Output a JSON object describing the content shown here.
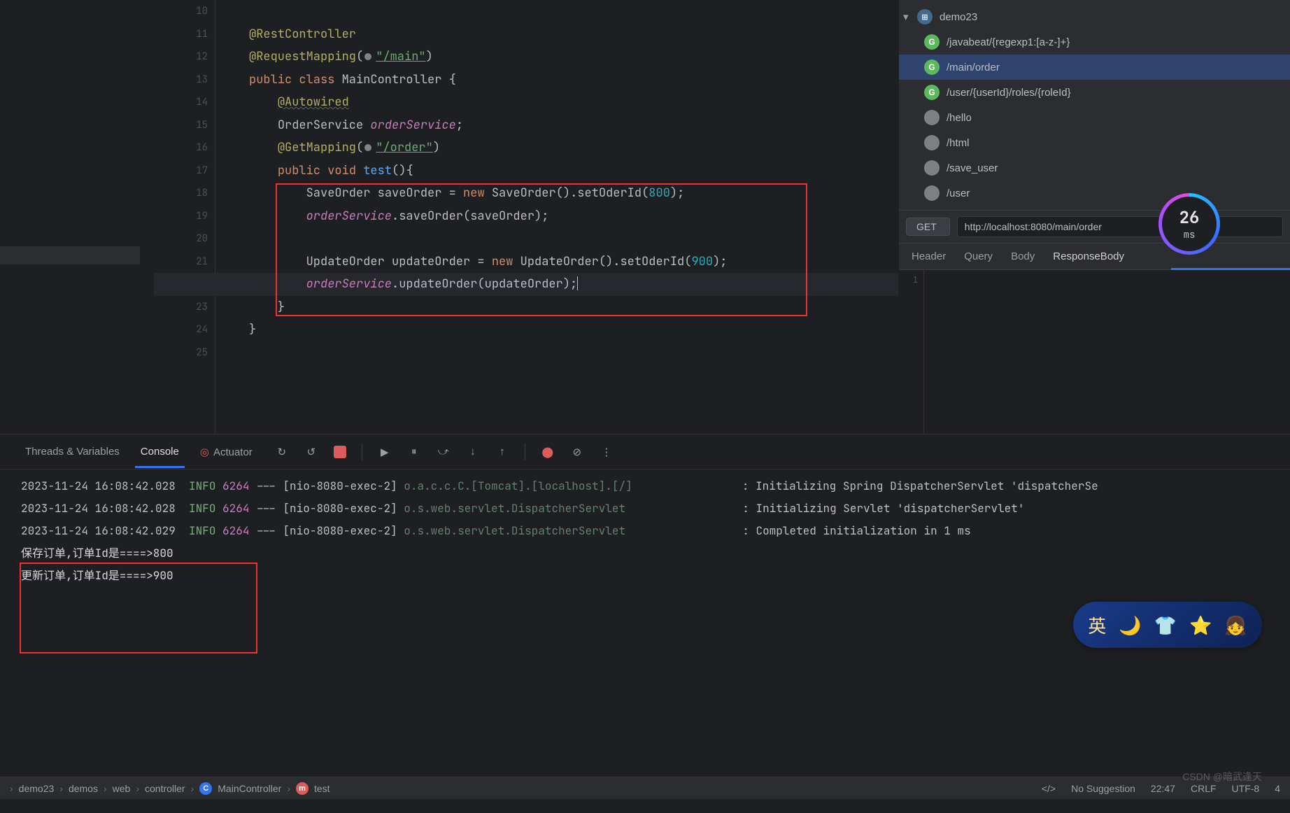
{
  "editor": {
    "lines": {
      "start": 10,
      "end": 25
    },
    "code": {
      "l11_ann": "@RestController",
      "l12_ann": "@RequestMapping",
      "l12_str": "\"/main\"",
      "l13_kw1": "public",
      "l13_kw2": "class",
      "l13_name": "MainController",
      "l14_ann": "@Autowired",
      "l15_type": "OrderService",
      "l15_field": "orderService",
      "l16_ann": "@GetMapping",
      "l16_str": "\"/order\"",
      "l17_kw1": "public",
      "l17_kw2": "void",
      "l17_name": "test",
      "l18_t1": "SaveOrder",
      "l18_v1": "saveOrder",
      "l18_kw": "new",
      "l18_t2": "SaveOrder",
      "l18_m": "setOderId",
      "l18_n": "800",
      "l19_f": "orderService",
      "l19_m": "saveOrder",
      "l19_a": "saveOrder",
      "l21_t1": "UpdateOrder",
      "l21_v1": "updateOrder",
      "l21_kw": "new",
      "l21_t2": "UpdateOrder",
      "l21_m": "setOderId",
      "l21_n": "900",
      "l22_f": "orderService",
      "l22_m": "updateOrder",
      "l22_a": "updateOrder"
    }
  },
  "endpoints_panel": {
    "root": "demo23",
    "items": [
      {
        "method": "G",
        "path": "/javabeat/{regexp1:[a-z-]+}"
      },
      {
        "method": "G",
        "path": "/main/order",
        "selected": true
      },
      {
        "method": "G",
        "path": "/user/{userId}/roles/{roleId}"
      },
      {
        "method": "",
        "path": "/hello"
      },
      {
        "method": "",
        "path": "/html"
      },
      {
        "method": "",
        "path": "/save_user"
      },
      {
        "method": "",
        "path": "/user"
      }
    ],
    "request": {
      "method": "GET",
      "url": "http://localhost:8080/main/order"
    },
    "tabs": [
      "Header",
      "Query",
      "Body",
      "ResponseBody"
    ],
    "tab_selected": "ResponseBody",
    "response_gutter": "1",
    "timing": {
      "value": "26",
      "unit": "ms"
    }
  },
  "debug_panel": {
    "tabs": {
      "threads": "Threads & Variables",
      "console": "Console",
      "actuator": "Actuator"
    },
    "log": [
      {
        "ts": "2023-11-24 16:08:42.028",
        "lvl": "INFO",
        "pid": "6264",
        "pre": "--- [nio-8080-exec-2]",
        "logger": "o.a.c.c.C.[Tomcat].[localhost].[/]",
        "msg": ": Initializing Spring DispatcherServlet 'dispatcherSe"
      },
      {
        "ts": "2023-11-24 16:08:42.028",
        "lvl": "INFO",
        "pid": "6264",
        "pre": "--- [nio-8080-exec-2]",
        "logger": "o.s.web.servlet.DispatcherServlet",
        "msg": ": Initializing Servlet 'dispatcherServlet'"
      },
      {
        "ts": "2023-11-24 16:08:42.029",
        "lvl": "INFO",
        "pid": "6264",
        "pre": "--- [nio-8080-exec-2]",
        "logger": "o.s.web.servlet.DispatcherServlet",
        "msg": ": Completed initialization in 1 ms"
      }
    ],
    "out": [
      "保存订单,订单Id是====>800",
      "更新订单,订单Id是====>900"
    ]
  },
  "status_bar": {
    "crumbs": [
      "demo23",
      "demos",
      "web",
      "controller",
      "MainController",
      "test"
    ],
    "crumb_icons": {
      "MainController": "C",
      "test": "m"
    },
    "right": {
      "suggestion": "No Suggestion",
      "time": "22:47",
      "eol": "CRLF",
      "encoding": "UTF-8",
      "spaces": "4"
    }
  },
  "watermark": "CSDN @暗武逢天",
  "ime_text": "英"
}
